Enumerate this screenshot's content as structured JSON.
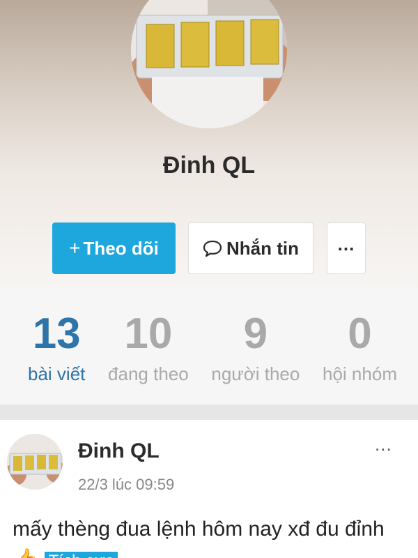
{
  "profile": {
    "name": "Đinh QL"
  },
  "actions": {
    "follow_icon": "+",
    "follow_label": "Theo dõi",
    "message_label": "Nhắn tin",
    "more_label": "..."
  },
  "stats": [
    {
      "value": "13",
      "label": "bài viết"
    },
    {
      "value": "10",
      "label": "đang theo"
    },
    {
      "value": "9",
      "label": "người theo"
    },
    {
      "value": "0",
      "label": "hội nhóm"
    }
  ],
  "post": {
    "author": "Đinh QL",
    "time": "22/3 lúc 09:59",
    "more": "...",
    "text": "mấy thèng đua lệnh hôm nay xđ đu đỉnh👍",
    "tag": "Tích cực"
  },
  "colors": {
    "accent": "#1ea7dc",
    "active_stat": "#2d74a8",
    "inactive_stat": "#a9a9a9"
  }
}
